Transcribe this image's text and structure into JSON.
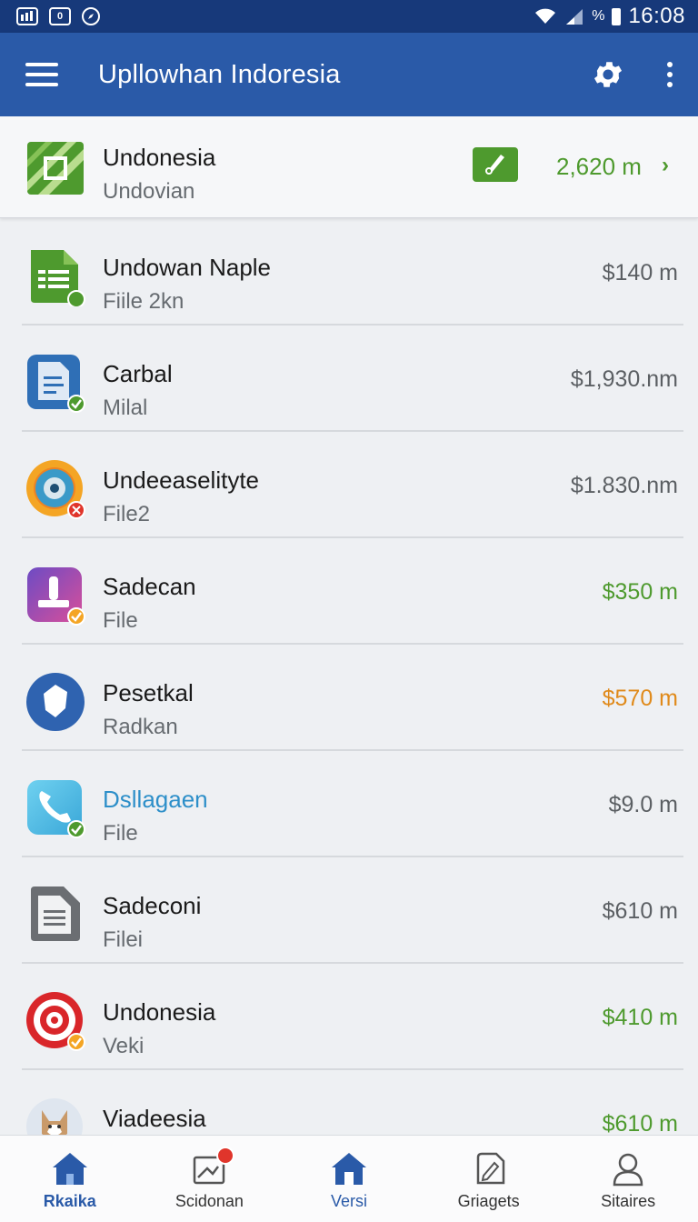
{
  "status_bar": {
    "icons_left": [
      "sim-card-icon",
      "0",
      "compass-icon"
    ],
    "signal_text": "%",
    "time": "16:08"
  },
  "app_bar": {
    "title": "Upllowhan Indoresia",
    "icons": [
      "menu-icon",
      "settings-icon",
      "more-vert-icon"
    ]
  },
  "header_item": {
    "title": "Undonesia",
    "subtitle": "Undovian",
    "amount": "2,620 m",
    "badge_icon": "check-edit-icon",
    "chevron": "›"
  },
  "items": [
    {
      "title": "Undowan Naple",
      "subtitle": "Fiile 2kn",
      "amount": "$140 m",
      "icon": "spreadsheet-icon"
    },
    {
      "title": "Carbal",
      "subtitle": "Milal",
      "amount": "$1,930.nm",
      "icon": "document-icon"
    },
    {
      "title": "Undeeaselityte",
      "subtitle": "File2",
      "amount": "$1.830.nm",
      "icon": "camera-lens-icon"
    },
    {
      "title": "Sadecan",
      "subtitle": "File",
      "amount": "$350 m",
      "icon": "stamp-icon"
    },
    {
      "title": "Pesetkal",
      "subtitle": "Radkan",
      "amount": "$570 m",
      "icon": "shield-icon"
    },
    {
      "title": "Dsllagaen",
      "subtitle": "File",
      "amount": "$9.0 m",
      "icon": "phone-icon"
    },
    {
      "title": "Sadeconi",
      "subtitle": "Filei",
      "amount": "$610 m",
      "icon": "file-text-icon"
    },
    {
      "title": "Undonesia",
      "subtitle": "Veki",
      "amount": "$410 m",
      "icon": "target-icon"
    },
    {
      "title": "Viadeesia",
      "subtitle": "",
      "amount": "$610 m",
      "icon": "fox-avatar-icon"
    }
  ],
  "bottom_nav": [
    {
      "label": "Rkaika",
      "icon": "home-icon",
      "active": true
    },
    {
      "label": "Scidonan",
      "icon": "image-notification-icon",
      "active": false
    },
    {
      "label": "Versi",
      "icon": "home-icon",
      "active": true
    },
    {
      "label": "Griagets",
      "icon": "edit-document-icon",
      "active": false
    },
    {
      "label": "Sitaires",
      "icon": "person-icon",
      "active": false
    }
  ],
  "colors": {
    "status_bar": "#17397a",
    "app_bar": "#2a5aa8",
    "positive": "#4e9a2e",
    "warning": "#e08a1a",
    "link": "#2d8fc9"
  }
}
